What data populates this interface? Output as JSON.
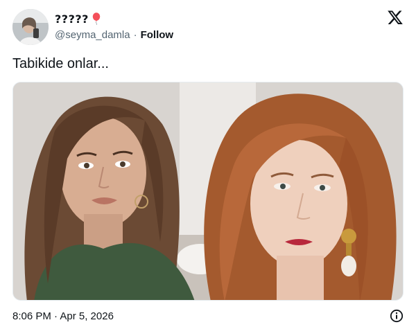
{
  "tweet": {
    "display_name": "?????",
    "handle": "@seyma_damla",
    "separator": "·",
    "follow_label": "Follow",
    "text": "Tabikide onlar...",
    "timestamp": "8:06 PM · Apr 5, 2026",
    "icons": {
      "name_badge": "balloon-icon",
      "platform": "x-logo-icon",
      "info": "info-icon"
    },
    "media": {
      "description_icon": "photo"
    }
  },
  "colors": {
    "text_primary": "#0f1419",
    "text_secondary": "#536471",
    "balloon": "#f4505a",
    "background": "#ffffff"
  }
}
